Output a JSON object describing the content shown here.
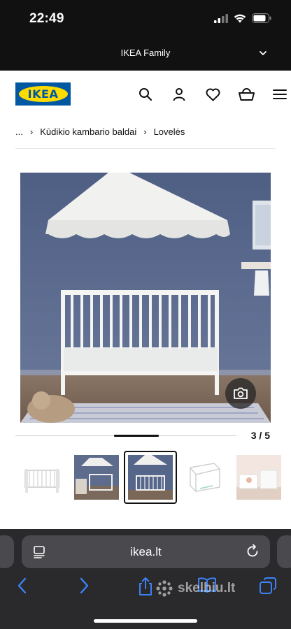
{
  "status_bar": {
    "time": "22:49"
  },
  "family_banner": {
    "label": "IKEA Family"
  },
  "header": {
    "logo_text": "IKEA",
    "icons": [
      "search-icon",
      "account-icon",
      "wishlist-icon",
      "cart-icon",
      "menu-icon"
    ]
  },
  "breadcrumb": {
    "ellipsis": "...",
    "items": [
      "Kūdikio kambario baldai",
      "Lovelės"
    ]
  },
  "gallery": {
    "current": 3,
    "total": 5,
    "counter_text": "3 / 5",
    "progress_fraction": 0.2
  },
  "browser": {
    "url": "ikea.lt"
  },
  "watermark": {
    "text": "skelbiu.lt"
  },
  "colors": {
    "ikea_blue": "#0058a3",
    "ikea_yellow": "#ffdb00",
    "wall_blue": "#5a6b8f"
  }
}
